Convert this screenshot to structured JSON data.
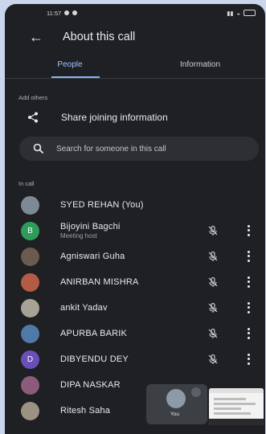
{
  "status_bar": {
    "time": "11:57"
  },
  "header": {
    "title": "About this call"
  },
  "tabs": [
    {
      "label": "People",
      "active": true
    },
    {
      "label": "Information",
      "active": false
    }
  ],
  "add_others": {
    "section_label": "Add others",
    "share_label": "Share joining information",
    "search_placeholder": "Search for someone in this call"
  },
  "in_call": {
    "section_label": "In call",
    "participants": [
      {
        "name": "SYED REHAN (You)",
        "subtitle": "",
        "avatar_letter": "",
        "avatar_color": "#7d8a96",
        "muted": false
      },
      {
        "name": "Bijoyini Bagchi",
        "subtitle": "Meeting host",
        "avatar_letter": "B",
        "avatar_color": "#2e9d5b",
        "muted": true
      },
      {
        "name": "Agniswari Guha",
        "subtitle": "",
        "avatar_letter": "",
        "avatar_color": "#6b5a4d",
        "muted": true
      },
      {
        "name": "ANIRBAN MISHRA",
        "subtitle": "",
        "avatar_letter": "",
        "avatar_color": "#b35b45",
        "muted": true
      },
      {
        "name": "ankit Yadav",
        "subtitle": "",
        "avatar_letter": "",
        "avatar_color": "#a8a296",
        "muted": true
      },
      {
        "name": "APURBA BARIK",
        "subtitle": "",
        "avatar_letter": "",
        "avatar_color": "#4f7aa8",
        "muted": true
      },
      {
        "name": "DIBYENDU DEY",
        "subtitle": "",
        "avatar_letter": "D",
        "avatar_color": "#6a4fb8",
        "muted": true
      },
      {
        "name": "DIPA NASKAR",
        "subtitle": "",
        "avatar_letter": "",
        "avatar_color": "#8a5b7a",
        "muted": false
      },
      {
        "name": "Ritesh Saha",
        "subtitle": "",
        "avatar_letter": "",
        "avatar_color": "#9b9284",
        "muted": false
      }
    ]
  },
  "self_tile": {
    "label": "You"
  },
  "colors": {
    "accent": "#8ab4f8",
    "background": "#1f2023"
  }
}
